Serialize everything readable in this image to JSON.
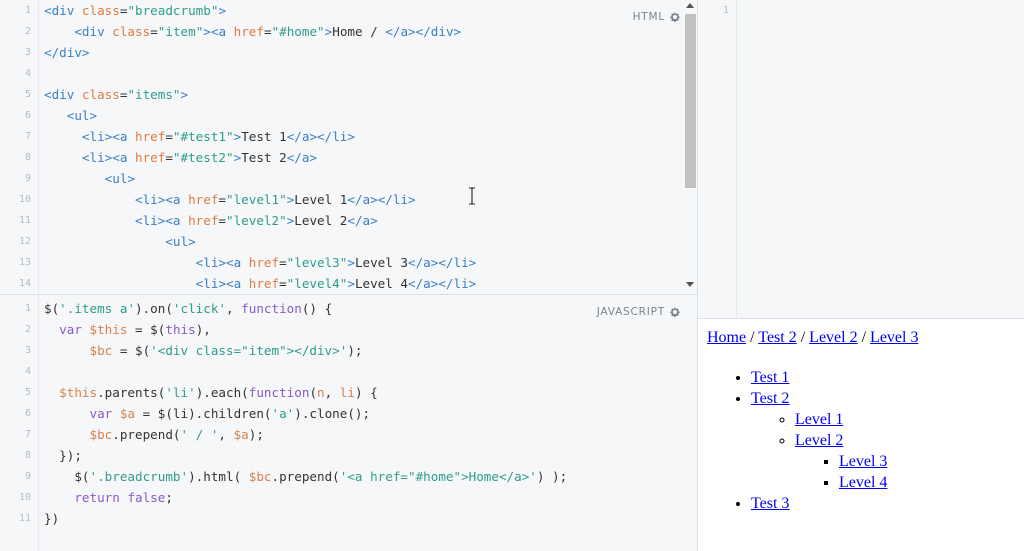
{
  "editor": {
    "html": {
      "label": "HTML",
      "lines": [
        {
          "n": "1",
          "parts": [
            [
              "t",
              "<div "
            ],
            [
              "a",
              "class"
            ],
            [
              "p",
              "="
            ],
            [
              "s",
              "\"breadcrumb\""
            ],
            [
              "t",
              ">"
            ]
          ]
        },
        {
          "n": "2",
          "parts": [
            [
              "p",
              "    "
            ],
            [
              "t",
              "<div "
            ],
            [
              "a",
              "class"
            ],
            [
              "p",
              "="
            ],
            [
              "s",
              "\"item\""
            ],
            [
              "t",
              "><a "
            ],
            [
              "a",
              "href"
            ],
            [
              "p",
              "="
            ],
            [
              "s",
              "\"#home\""
            ],
            [
              "t",
              ">"
            ],
            [
              "p",
              "Home / "
            ],
            [
              "t",
              "</a></div>"
            ]
          ]
        },
        {
          "n": "3",
          "parts": [
            [
              "t",
              "</div>"
            ]
          ]
        },
        {
          "n": "4",
          "parts": []
        },
        {
          "n": "5",
          "parts": [
            [
              "t",
              "<div "
            ],
            [
              "a",
              "class"
            ],
            [
              "p",
              "="
            ],
            [
              "s",
              "\"items\""
            ],
            [
              "t",
              ">"
            ]
          ]
        },
        {
          "n": "6",
          "parts": [
            [
              "p",
              "   "
            ],
            [
              "t",
              "<ul>"
            ]
          ]
        },
        {
          "n": "7",
          "parts": [
            [
              "p",
              "     "
            ],
            [
              "t",
              "<li><a "
            ],
            [
              "a",
              "href"
            ],
            [
              "p",
              "="
            ],
            [
              "s",
              "\"#test1\""
            ],
            [
              "t",
              ">"
            ],
            [
              "p",
              "Test 1"
            ],
            [
              "t",
              "</a></li>"
            ]
          ]
        },
        {
          "n": "8",
          "parts": [
            [
              "p",
              "     "
            ],
            [
              "t",
              "<li><a "
            ],
            [
              "a",
              "href"
            ],
            [
              "p",
              "="
            ],
            [
              "s",
              "\"#test2\""
            ],
            [
              "t",
              ">"
            ],
            [
              "p",
              "Test 2"
            ],
            [
              "t",
              "</a>"
            ]
          ]
        },
        {
          "n": "9",
          "parts": [
            [
              "p",
              "        "
            ],
            [
              "t",
              "<ul>"
            ]
          ]
        },
        {
          "n": "10",
          "parts": [
            [
              "p",
              "            "
            ],
            [
              "t",
              "<li><a "
            ],
            [
              "a",
              "href"
            ],
            [
              "p",
              "="
            ],
            [
              "s",
              "\"level1\""
            ],
            [
              "t",
              ">"
            ],
            [
              "p",
              "Level 1"
            ],
            [
              "t",
              "</a></li>"
            ]
          ]
        },
        {
          "n": "11",
          "parts": [
            [
              "p",
              "            "
            ],
            [
              "t",
              "<li><a "
            ],
            [
              "a",
              "href"
            ],
            [
              "p",
              "="
            ],
            [
              "s",
              "\"level2\""
            ],
            [
              "t",
              ">"
            ],
            [
              "p",
              "Level 2"
            ],
            [
              "t",
              "</a>"
            ]
          ]
        },
        {
          "n": "12",
          "parts": [
            [
              "p",
              "                "
            ],
            [
              "t",
              "<ul>"
            ]
          ]
        },
        {
          "n": "13",
          "parts": [
            [
              "p",
              "                    "
            ],
            [
              "t",
              "<li><a "
            ],
            [
              "a",
              "href"
            ],
            [
              "p",
              "="
            ],
            [
              "s",
              "\"level3\""
            ],
            [
              "t",
              ">"
            ],
            [
              "p",
              "Level 3"
            ],
            [
              "t",
              "</a></li>"
            ]
          ]
        },
        {
          "n": "14",
          "parts": [
            [
              "p",
              "                    "
            ],
            [
              "t",
              "<li><a "
            ],
            [
              "a",
              "href"
            ],
            [
              "p",
              "="
            ],
            [
              "s",
              "\"level4\""
            ],
            [
              "t",
              ">"
            ],
            [
              "p",
              "Level 4"
            ],
            [
              "t",
              "</a></li>"
            ]
          ]
        }
      ]
    },
    "javascript": {
      "label": "JAVASCRIPT",
      "lines": [
        {
          "n": "1",
          "parts": [
            [
              "p",
              "$("
            ],
            [
              "s",
              "'.items a'"
            ],
            [
              "p",
              ").on("
            ],
            [
              "s",
              "'click'"
            ],
            [
              "p",
              ", "
            ],
            [
              "k",
              "function"
            ],
            [
              "p",
              "() {"
            ]
          ]
        },
        {
          "n": "2",
          "parts": [
            [
              "p",
              "  "
            ],
            [
              "k",
              "var"
            ],
            [
              "p",
              " "
            ],
            [
              "v",
              "$this"
            ],
            [
              "p",
              " = $("
            ],
            [
              "k",
              "this"
            ],
            [
              "p",
              "),"
            ]
          ]
        },
        {
          "n": "3",
          "parts": [
            [
              "p",
              "      "
            ],
            [
              "v",
              "$bc"
            ],
            [
              "p",
              " = $("
            ],
            [
              "s",
              "'<div class=\"item\"></div>'"
            ],
            [
              "p",
              ");"
            ]
          ]
        },
        {
          "n": "4",
          "parts": []
        },
        {
          "n": "5",
          "parts": [
            [
              "p",
              "  "
            ],
            [
              "v",
              "$this"
            ],
            [
              "p",
              ".parents("
            ],
            [
              "s",
              "'li'"
            ],
            [
              "p",
              ").each("
            ],
            [
              "k",
              "function"
            ],
            [
              "p",
              "("
            ],
            [
              "v",
              "n"
            ],
            [
              "p",
              ", "
            ],
            [
              "v",
              "li"
            ],
            [
              "p",
              ") {"
            ]
          ]
        },
        {
          "n": "6",
          "parts": [
            [
              "p",
              "      "
            ],
            [
              "k",
              "var"
            ],
            [
              "p",
              " "
            ],
            [
              "v",
              "$a"
            ],
            [
              "p",
              " = $(li).children("
            ],
            [
              "s",
              "'a'"
            ],
            [
              "p",
              ").clone();"
            ]
          ]
        },
        {
          "n": "7",
          "parts": [
            [
              "p",
              "      "
            ],
            [
              "v",
              "$bc"
            ],
            [
              "p",
              ".prepend("
            ],
            [
              "s",
              "' / '"
            ],
            [
              "p",
              ", "
            ],
            [
              "v",
              "$a"
            ],
            [
              "p",
              ");"
            ]
          ]
        },
        {
          "n": "8",
          "parts": [
            [
              "p",
              "  });"
            ]
          ]
        },
        {
          "n": "9",
          "parts": [
            [
              "p",
              "    $("
            ],
            [
              "s",
              "'.breadcrumb'"
            ],
            [
              "p",
              ").html( "
            ],
            [
              "v",
              "$bc"
            ],
            [
              "p",
              ".prepend("
            ],
            [
              "s",
              "'<a href=\"#home\">Home</a>'"
            ],
            [
              "p",
              ") );"
            ]
          ]
        },
        {
          "n": "10",
          "parts": [
            [
              "p",
              "    "
            ],
            [
              "k",
              "return"
            ],
            [
              "p",
              " "
            ],
            [
              "k",
              "false"
            ],
            [
              "p",
              ";"
            ]
          ]
        },
        {
          "n": "11",
          "parts": [
            [
              "p",
              "})"
            ]
          ]
        }
      ]
    },
    "css": {
      "lines": [
        {
          "n": "1",
          "parts": []
        }
      ]
    }
  },
  "result": {
    "breadcrumb": [
      {
        "label": "Home"
      },
      {
        "label": "Test 2"
      },
      {
        "label": "Level 2"
      },
      {
        "label": "Level 3"
      }
    ],
    "separator": "/",
    "list": {
      "test1": "Test 1",
      "test2": "Test 2",
      "level1": "Level 1",
      "level2": "Level 2",
      "level3": "Level 3",
      "level4": "Level 4",
      "test3": "Test 3"
    }
  },
  "colors": {
    "tag": "#3b7fc4",
    "attr": "#e07c3e",
    "string": "#2f9c8c",
    "keyword": "#8c59c7",
    "editor_bg": "#f5f7f9",
    "link": "#0000ee"
  },
  "icons": {
    "settings": "gear-icon",
    "text-cursor": "ibeam-cursor-icon"
  }
}
